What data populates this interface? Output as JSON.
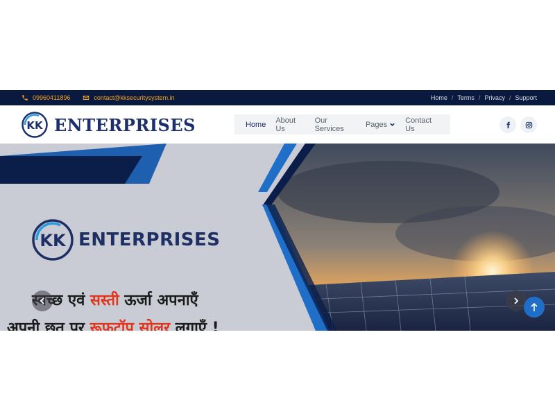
{
  "topbar": {
    "phone": "09960411896",
    "email": "contact@kksecuritysystem.in",
    "links": [
      "Home",
      "Terms",
      "Privacy",
      "Support"
    ]
  },
  "header": {
    "logo_mark": "KK",
    "logo_text": "ENTERPRISES",
    "nav": [
      {
        "label": "Home",
        "active": true
      },
      {
        "label": "About Us"
      },
      {
        "label": "Our Services"
      },
      {
        "label": "Pages",
        "has_dropdown": true
      },
      {
        "label": "Contact Us"
      }
    ],
    "social": [
      "facebook-icon",
      "instagram-icon"
    ]
  },
  "hero": {
    "logo_mark": "KK",
    "logo_text": "ENTERPRISES",
    "line1_a": "स्वच्छ एवं ",
    "line1_b": "सस्ती",
    "line1_c": " ऊर्जा अपनाएँ",
    "line2_a": "अपनी छत पर ",
    "line2_b": "रूफटॉप सोलर",
    "line2_c": " लगाएँ !"
  },
  "colors": {
    "topbar_bg": "#0a1a3f",
    "accent_orange": "#f6a21c",
    "brand_navy": "#1c2f6c",
    "hero_red": "#e0361e",
    "scroll_top_blue": "#1f6ec7"
  }
}
